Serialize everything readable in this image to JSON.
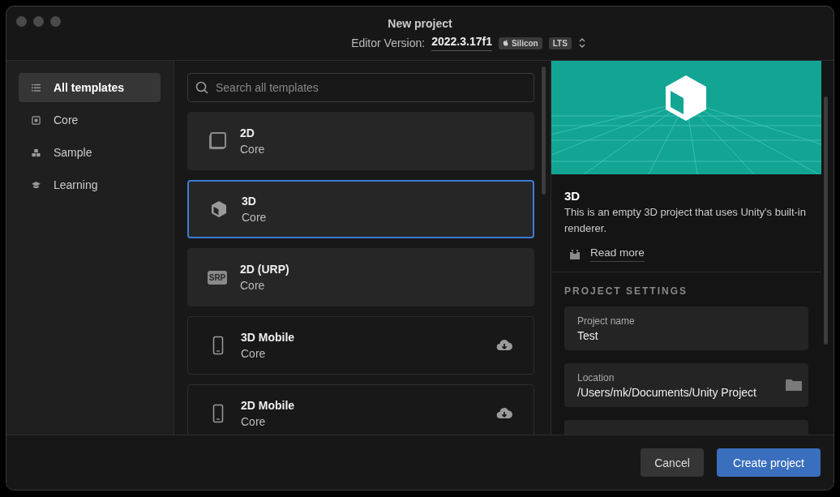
{
  "window": {
    "title": "New project"
  },
  "editor_version": {
    "label": "Editor Version:",
    "value": "2022.3.17f1",
    "badges": [
      {
        "kind": "apple",
        "label": "Silicon"
      },
      {
        "kind": "plain",
        "label": "LTS"
      }
    ]
  },
  "sidebar": {
    "items": [
      {
        "label": "All templates",
        "kind": "list",
        "selected": true
      },
      {
        "label": "Core",
        "kind": "core",
        "selected": false
      },
      {
        "label": "Sample",
        "kind": "sample",
        "selected": false
      },
      {
        "label": "Learning",
        "kind": "learning",
        "selected": false
      }
    ]
  },
  "search": {
    "placeholder": "Search all templates"
  },
  "templates": [
    {
      "name": "2D",
      "category": "Core",
      "kind": "square",
      "installed": true,
      "selected": false
    },
    {
      "name": "3D",
      "category": "Core",
      "kind": "cube",
      "installed": true,
      "selected": true
    },
    {
      "name": "2D (URP)",
      "category": "Core",
      "kind": "srp",
      "icon_text": "SRP",
      "installed": true,
      "selected": false
    },
    {
      "name": "3D Mobile",
      "category": "Core",
      "kind": "phone",
      "installed": false,
      "selected": false
    },
    {
      "name": "2D Mobile",
      "category": "Core",
      "kind": "phone",
      "installed": false,
      "selected": false
    }
  ],
  "details": {
    "title": "3D",
    "description": "This is an empty 3D project that uses Unity's built-in renderer.",
    "read_more": "Read more"
  },
  "project_settings": {
    "heading": "PROJECT SETTINGS",
    "fields": [
      {
        "label": "Project name",
        "value": "Test",
        "kind": "text"
      },
      {
        "label": "Location",
        "value": "/Users/mk/Documents/Unity Project",
        "kind": "folder"
      }
    ]
  },
  "buttons": [
    {
      "label": "Cancel",
      "kind": "secondary"
    },
    {
      "label": "Create project",
      "kind": "primary"
    }
  ]
}
